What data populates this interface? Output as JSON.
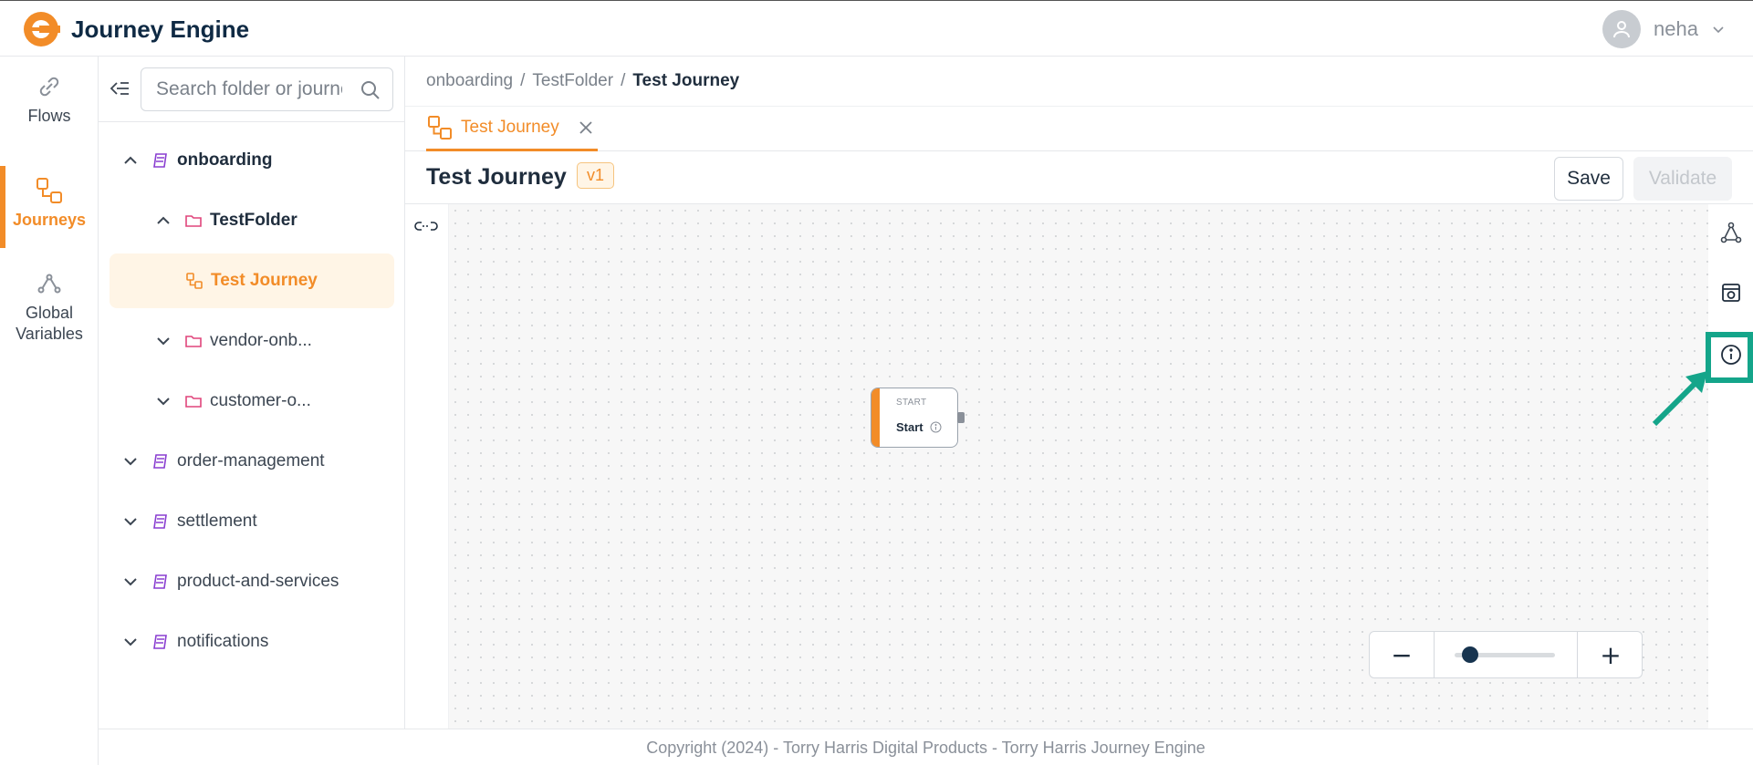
{
  "app": {
    "title": "Journey Engine",
    "accent": "#f28c28"
  },
  "user": {
    "name": "neha"
  },
  "nav": {
    "items": [
      {
        "label": "Flows",
        "icon": "link-icon"
      },
      {
        "label": "Journeys",
        "icon": "journeys-icon",
        "active": true
      },
      {
        "label": "Global Variables",
        "icon": "variables-icon"
      }
    ]
  },
  "folders": {
    "search_placeholder": "Search folder or journey",
    "tree": [
      {
        "label": "onboarding",
        "expanded": true
      },
      {
        "label": "TestFolder",
        "expanded": true
      },
      {
        "label": "Test Journey",
        "selected": true
      },
      {
        "label": "vendor-onb..."
      },
      {
        "label": "customer-o..."
      },
      {
        "label": "order-management"
      },
      {
        "label": "settlement"
      },
      {
        "label": "product-and-services"
      },
      {
        "label": "notifications"
      }
    ]
  },
  "breadcrumb": {
    "items": [
      "onboarding",
      "TestFolder"
    ],
    "current": "Test Journey"
  },
  "tab": {
    "label": "Test Journey"
  },
  "journey": {
    "title": "Test Journey",
    "version": "v1",
    "save_label": "Save",
    "validate_label": "Validate"
  },
  "node": {
    "type": "START",
    "name": "Start"
  },
  "zoom": {
    "minus": "−",
    "plus": "+",
    "level": 0.15
  },
  "footer": {
    "text": "Copyright (2024) - Torry Harris Digital Products - Torry Harris Journey Engine"
  }
}
